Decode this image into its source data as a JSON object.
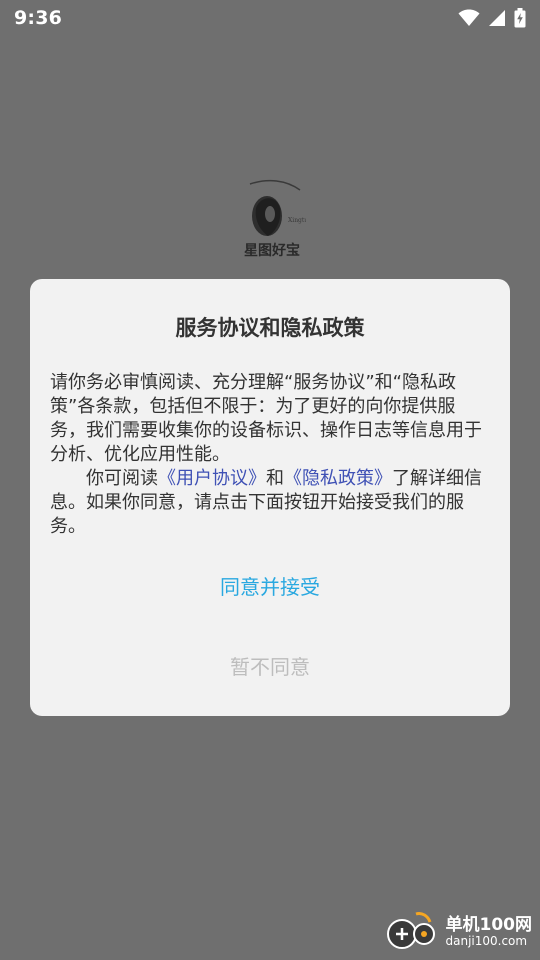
{
  "status_bar": {
    "time": "9:36",
    "icons": [
      "wifi-icon",
      "cellular-signal-icon",
      "battery-charging-icon"
    ]
  },
  "app": {
    "logo_text": "星图好宝"
  },
  "dialog": {
    "title": "服务协议和隐私政策",
    "para1": "请你务必审慎阅读、充分理解“服务协议”和“隐私政策”各条款，包括但不限于：为了更好的向你提供服务，我们需要收集你的设备标识、操作日志等信息用于分析、优化应用性能。",
    "para2_prefix": "你可阅读",
    "user_agreement_link": "《用户协议》",
    "para2_and": "和",
    "privacy_policy_link": "《隐私政策》",
    "para2_suffix": "了解详细信息。如果你同意，请点击下面按钮开始接受我们的服务。",
    "accept_label": "同意并接受",
    "decline_label": "暂不同意"
  },
  "watermark": {
    "name": "单机100网",
    "url": "danji100.com"
  },
  "colors": {
    "overlay_bg": "#6f6f6f",
    "dialog_bg": "#f2f2f2",
    "accept": "#29a8e0",
    "decline": "#bdbdbd",
    "link": "#3f51b5"
  }
}
